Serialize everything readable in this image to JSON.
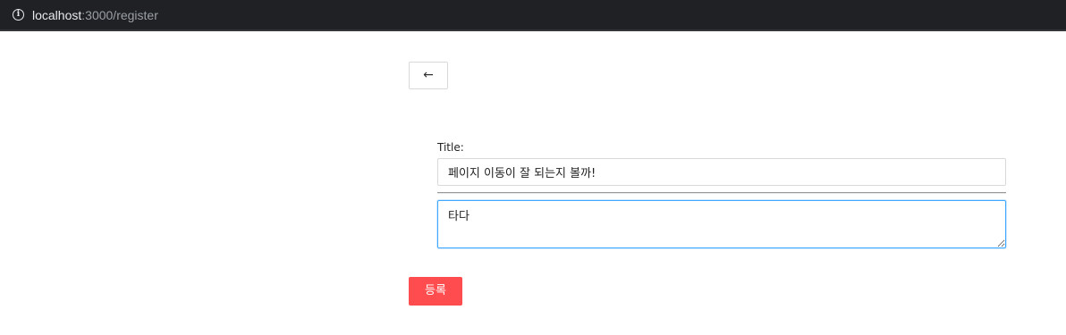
{
  "browser": {
    "info_icon": "info-icon",
    "url_host": "localhost",
    "url_path": ":3000/register"
  },
  "page": {
    "back_label": "←",
    "title_label": "Title:",
    "title_value": "페이지 이동이 잘 되는지 볼까!",
    "content_value": "타다",
    "submit_label": "등록"
  },
  "colors": {
    "submit_bg": "#ff4d4f",
    "focus_border": "#40a9ff",
    "address_bar_bg": "#202124"
  }
}
